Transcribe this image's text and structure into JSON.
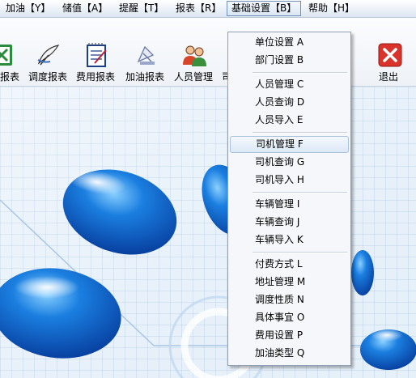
{
  "menubar": {
    "items": [
      "加油【Y】",
      "储值【A】",
      "提醒【T】",
      "报表【R】",
      "基础设置【B】",
      "帮助【H】"
    ]
  },
  "toolbar": {
    "buttons": [
      {
        "label": "报表",
        "icon": "spreadsheet-icon"
      },
      {
        "label": "调度报表",
        "icon": "quill-pen-icon"
      },
      {
        "label": "费用报表",
        "icon": "notepad-icon"
      },
      {
        "label": "加油报表",
        "icon": "fuel-report-icon"
      },
      {
        "label": "人员管理",
        "icon": "users-icon"
      },
      {
        "label": "司",
        "icon": "driver-icon"
      },
      {
        "label": "退出",
        "icon": "exit-icon"
      }
    ]
  },
  "dropdown": {
    "items": [
      "单位设置 A",
      "部门设置 B",
      "人员管理 C",
      "人员查询 D",
      "人员导入 E",
      "司机管理 F",
      "司机查询 G",
      "司机导入 H",
      "车辆管理 I",
      "车辆查询 J",
      "车辆导入 K",
      "付费方式 L",
      "地址管理 M",
      "调度性质 N",
      "具体事宜 O",
      "费用设置 P",
      "加油类型 Q"
    ],
    "highlighted": "司机管理 F"
  },
  "colors": {
    "accent": "#1e5fbf",
    "background": "#e9f1f9",
    "exit_red": "#d9332b"
  }
}
